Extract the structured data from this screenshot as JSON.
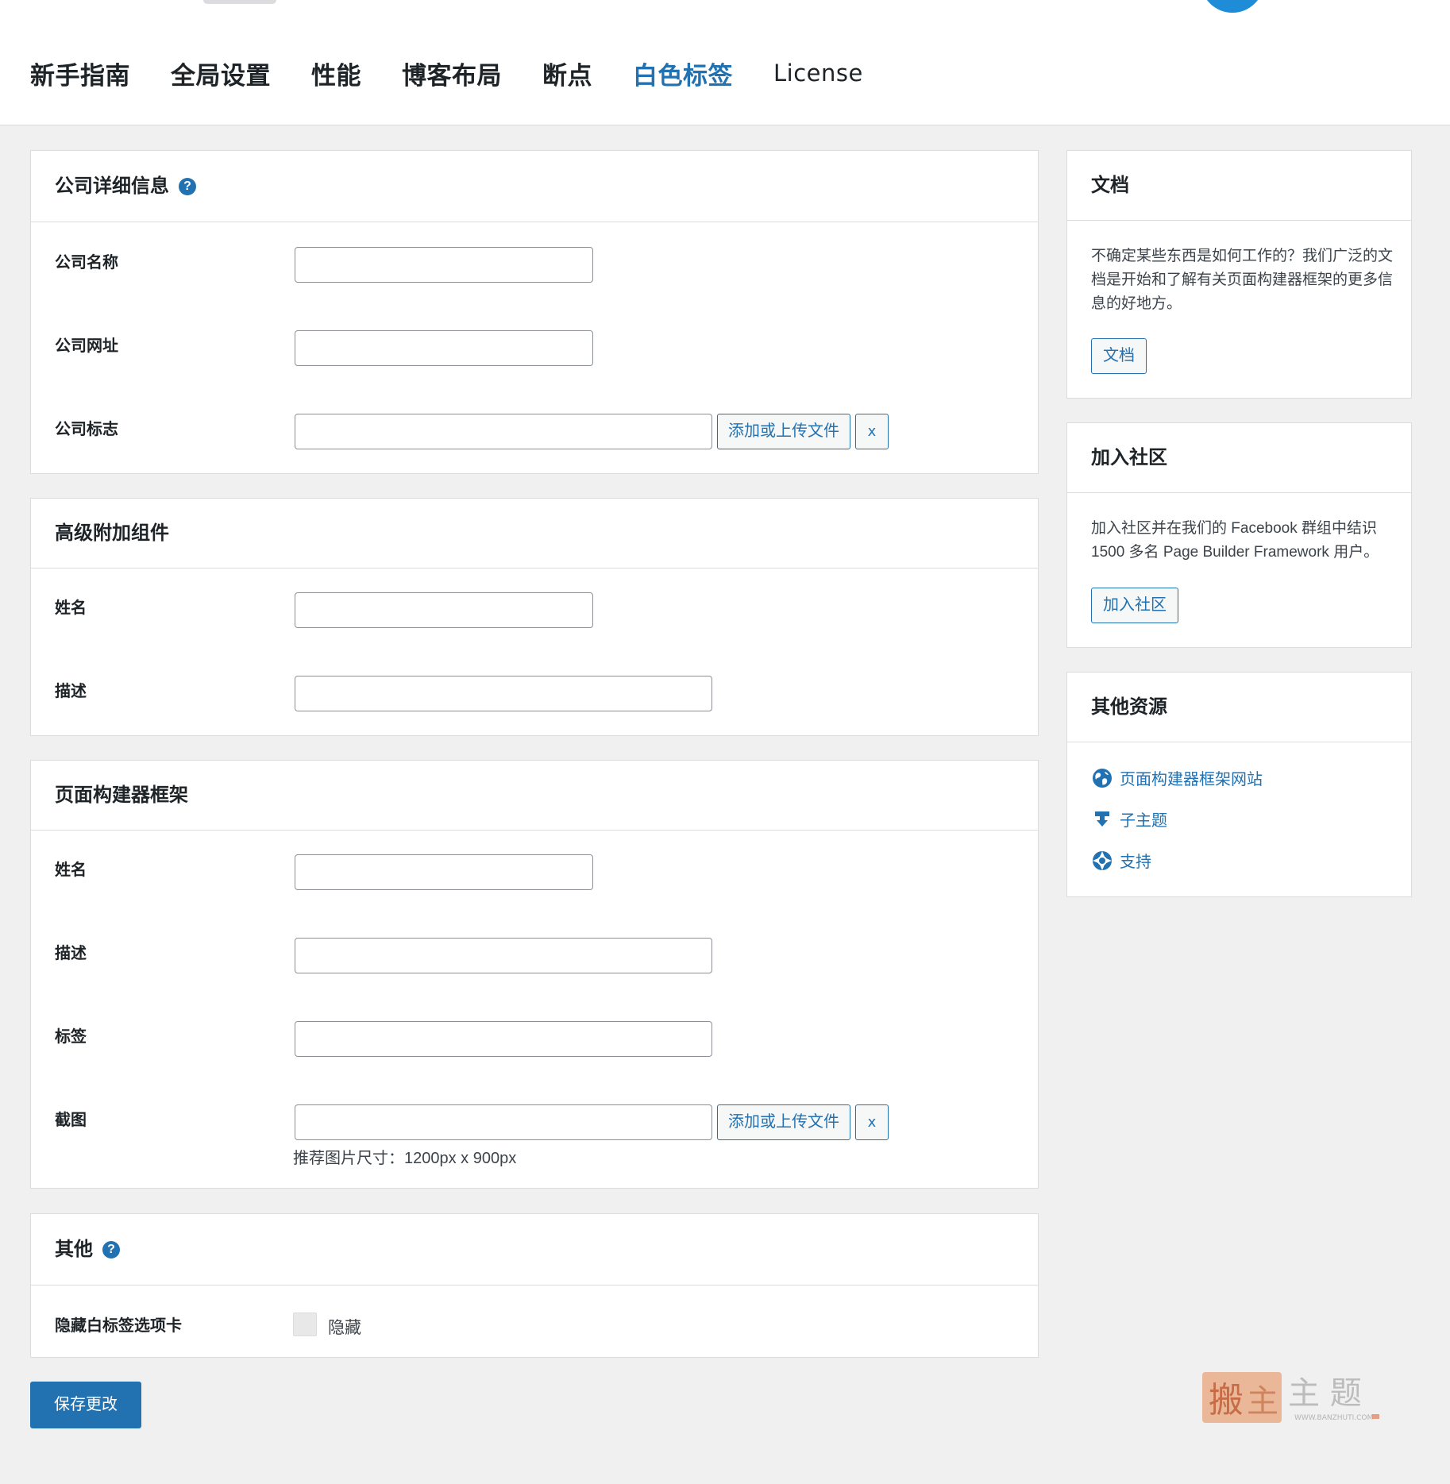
{
  "tabs": [
    {
      "label": "新手指南"
    },
    {
      "label": "全局设置"
    },
    {
      "label": "性能"
    },
    {
      "label": "博客布局"
    },
    {
      "label": "断点"
    },
    {
      "label": "白色标签"
    },
    {
      "label": "License"
    }
  ],
  "company": {
    "title": "公司详细信息",
    "help_icon": "?",
    "name_label": "公司名称",
    "url_label": "公司网址",
    "logo_label": "公司标志",
    "upload_label": "添加或上传文件",
    "clear_label": "x"
  },
  "advanced": {
    "title": "高级附加组件",
    "name_label": "姓名",
    "desc_label": "描述"
  },
  "framework": {
    "title": "页面构建器框架",
    "name_label": "姓名",
    "desc_label": "描述",
    "tags_label": "标签",
    "screenshot_label": "截图",
    "upload_label": "添加或上传文件",
    "clear_label": "x",
    "hint": "推荐图片尺寸：1200px x 900px"
  },
  "other": {
    "title": "其他",
    "help_icon": "?",
    "hide_label": "隐藏白标签选项卡",
    "checkbox_label": "隐藏",
    "checked": false
  },
  "save_label": "保存更改",
  "sidebar": {
    "docs": {
      "title": "文档",
      "text": "不确定某些东西是如何工作的？我们广泛的文档是开始和了解有关页面构建器框架的更多信息的好地方。",
      "button": "文档"
    },
    "community": {
      "title": "加入社区",
      "text": "加入社区并在我们的 Facebook 群组中结识 1500 多名 Page Builder Framework 用户。",
      "button": "加入社区"
    },
    "resources": {
      "title": "其他资源",
      "links": [
        {
          "label": "页面构建器框架网站",
          "icon": "globe-icon"
        },
        {
          "label": "子主题",
          "icon": "download-icon"
        },
        {
          "label": "支持",
          "icon": "lifebuoy-icon"
        }
      ]
    }
  },
  "colors": {
    "accent": "#2271b1",
    "background": "#f0f0f1",
    "panel": "#ffffff",
    "border": "#dcdcde",
    "text": "#1d2327"
  },
  "watermark": {
    "main": "主 题",
    "sub": "WWW.BANZHUTI.COM"
  }
}
